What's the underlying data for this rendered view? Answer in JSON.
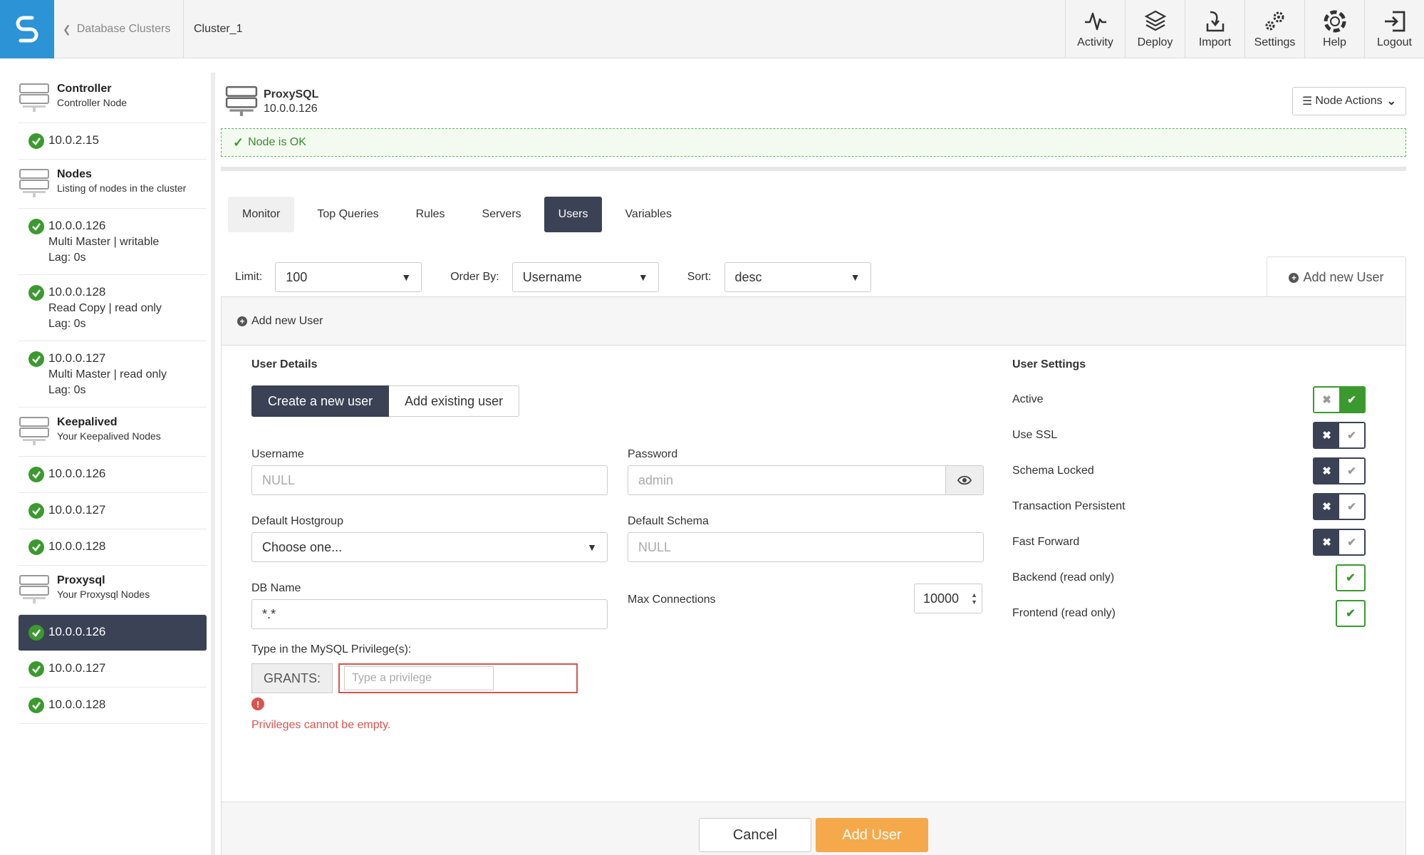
{
  "header": {
    "back_label": "Database Clusters",
    "current": "Cluster_1",
    "nav": [
      {
        "label": "Activity",
        "icon": "activity-icon"
      },
      {
        "label": "Deploy",
        "icon": "deploy-icon"
      },
      {
        "label": "Import",
        "icon": "import-icon"
      },
      {
        "label": "Settings",
        "icon": "settings-icon"
      },
      {
        "label": "Help",
        "icon": "help-icon"
      },
      {
        "label": "Logout",
        "icon": "logout-icon"
      }
    ]
  },
  "sidebar": {
    "controller": {
      "title": "Controller",
      "subtitle": "Controller Node",
      "node": "10.0.2.15"
    },
    "nodes": {
      "title": "Nodes",
      "subtitle": "Listing of nodes in the cluster",
      "items": [
        {
          "ip": "10.0.0.126",
          "role": "Multi Master | writable",
          "lag": "Lag: 0s"
        },
        {
          "ip": "10.0.0.128",
          "role": "Read Copy | read only",
          "lag": "Lag: 0s"
        },
        {
          "ip": "10.0.0.127",
          "role": "Multi Master | read only",
          "lag": "Lag: 0s"
        }
      ]
    },
    "keepalived": {
      "title": "Keepalived",
      "subtitle": "Your Keepalived Nodes",
      "items": [
        "10.0.0.126",
        "10.0.0.127",
        "10.0.0.128"
      ]
    },
    "proxysql": {
      "title": "Proxysql",
      "subtitle": "Your Proxysql Nodes",
      "items": [
        "10.0.0.126",
        "10.0.0.127",
        "10.0.0.128"
      ],
      "active_index": 0
    }
  },
  "node": {
    "title": "ProxySQL",
    "ip": "10.0.0.126",
    "actions_label": "Node Actions",
    "status": "Node is OK"
  },
  "tabs": [
    "Monitor",
    "Top Queries",
    "Rules",
    "Servers",
    "Users",
    "Variables"
  ],
  "active_tab": "Users",
  "filters": {
    "limit_label": "Limit:",
    "limit_value": "100",
    "order_label": "Order By:",
    "order_value": "Username",
    "sort_label": "Sort:",
    "sort_value": "desc",
    "add_tab_label": "Add new User"
  },
  "form": {
    "panel_title": "Add new User",
    "user_details_title": "User Details",
    "mode_create": "Create a new user",
    "mode_existing": "Add existing user",
    "username_label": "Username",
    "username_placeholder": "NULL",
    "password_label": "Password",
    "password_placeholder": "admin",
    "hostgroup_label": "Default Hostgroup",
    "hostgroup_value": "Choose one...",
    "schema_label": "Default Schema",
    "schema_placeholder": "NULL",
    "dbname_label": "DB Name",
    "dbname_value": "*.*",
    "maxconn_label": "Max Connections",
    "maxconn_value": "10000",
    "privilege_label": "Type in the MySQL Privilege(s):",
    "grants_label": "GRANTS:",
    "privilege_placeholder": "Type a privilege",
    "error_icon": "!",
    "error_message": "Privileges cannot be empty."
  },
  "settings": {
    "title": "User Settings",
    "toggles": [
      {
        "label": "Active",
        "on": true
      },
      {
        "label": "Use SSL",
        "on": false
      },
      {
        "label": "Schema Locked",
        "on": false
      },
      {
        "label": "Transaction Persistent",
        "on": false
      },
      {
        "label": "Fast Forward",
        "on": false
      }
    ],
    "readonly": [
      {
        "label": "Backend (read only)",
        "checked": true
      },
      {
        "label": "Frontend (read only)",
        "checked": true
      }
    ]
  },
  "footer": {
    "cancel_label": "Cancel",
    "add_label": "Add User"
  },
  "colors": {
    "accent": "#2b93d6",
    "dark": "#3b4255",
    "success": "#3a9a2e",
    "error": "#d9534f",
    "primary_button": "#f5a94a"
  }
}
